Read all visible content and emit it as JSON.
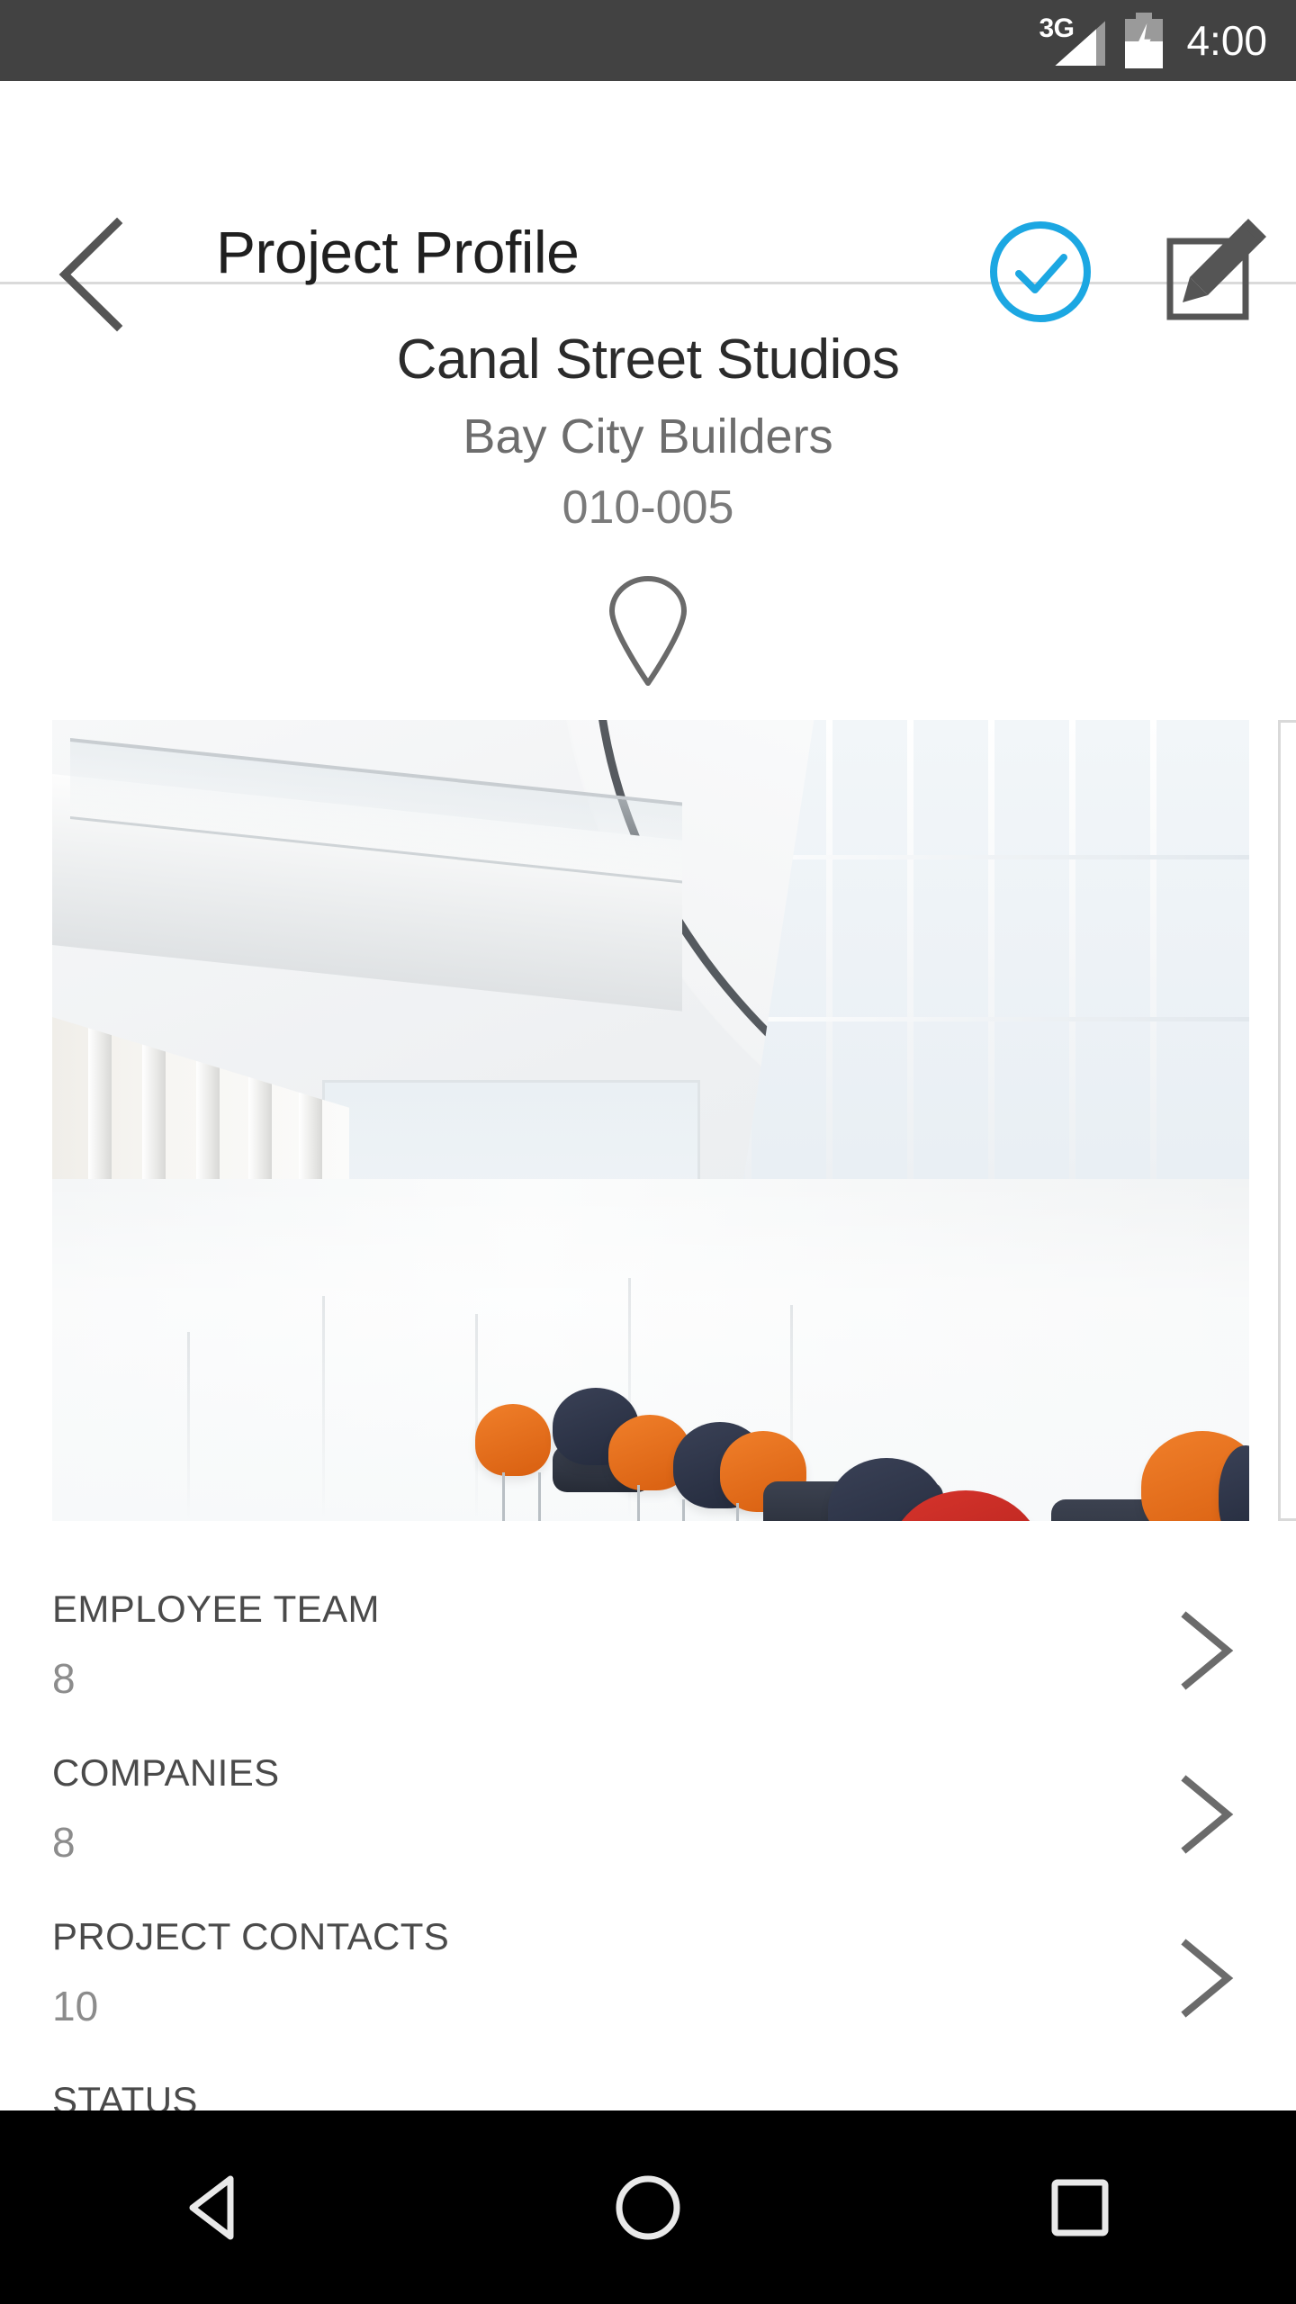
{
  "status_bar": {
    "network_label": "3G",
    "battery_icon": "battery-charging-icon",
    "signal_icon": "signal-bars-icon",
    "time": "4:00"
  },
  "app_bar": {
    "back_icon": "back-chevron-icon",
    "title": "Project Profile",
    "approve_icon": "check-circle-icon",
    "edit_icon": "edit-pencil-square-icon",
    "accent_color": "#1CA7E2",
    "icon_color": "#555555"
  },
  "project": {
    "name": "Canal Street Studios",
    "company": "Bay City Builders",
    "number": "010-005",
    "location_icon": "map-pin-icon"
  },
  "photos": {
    "count_visible": 2,
    "items": [
      {
        "alt": "Modern building atrium lobby with glass curtain wall and lounge chairs"
      },
      {
        "alt": ""
      }
    ]
  },
  "details": {
    "rows": [
      {
        "label": "EMPLOYEE TEAM",
        "value": "8",
        "chevron_icon": "chevron-right-icon"
      },
      {
        "label": "COMPANIES",
        "value": "8",
        "chevron_icon": "chevron-right-icon"
      },
      {
        "label": "PROJECT CONTACTS",
        "value": "10",
        "chevron_icon": "chevron-right-icon"
      },
      {
        "label": "STATUS",
        "value": "",
        "chevron_icon": "chevron-right-icon"
      }
    ]
  },
  "nav_bar": {
    "back_icon": "android-back-triangle-icon",
    "home_icon": "android-home-circle-icon",
    "recents_icon": "android-recents-square-icon"
  }
}
